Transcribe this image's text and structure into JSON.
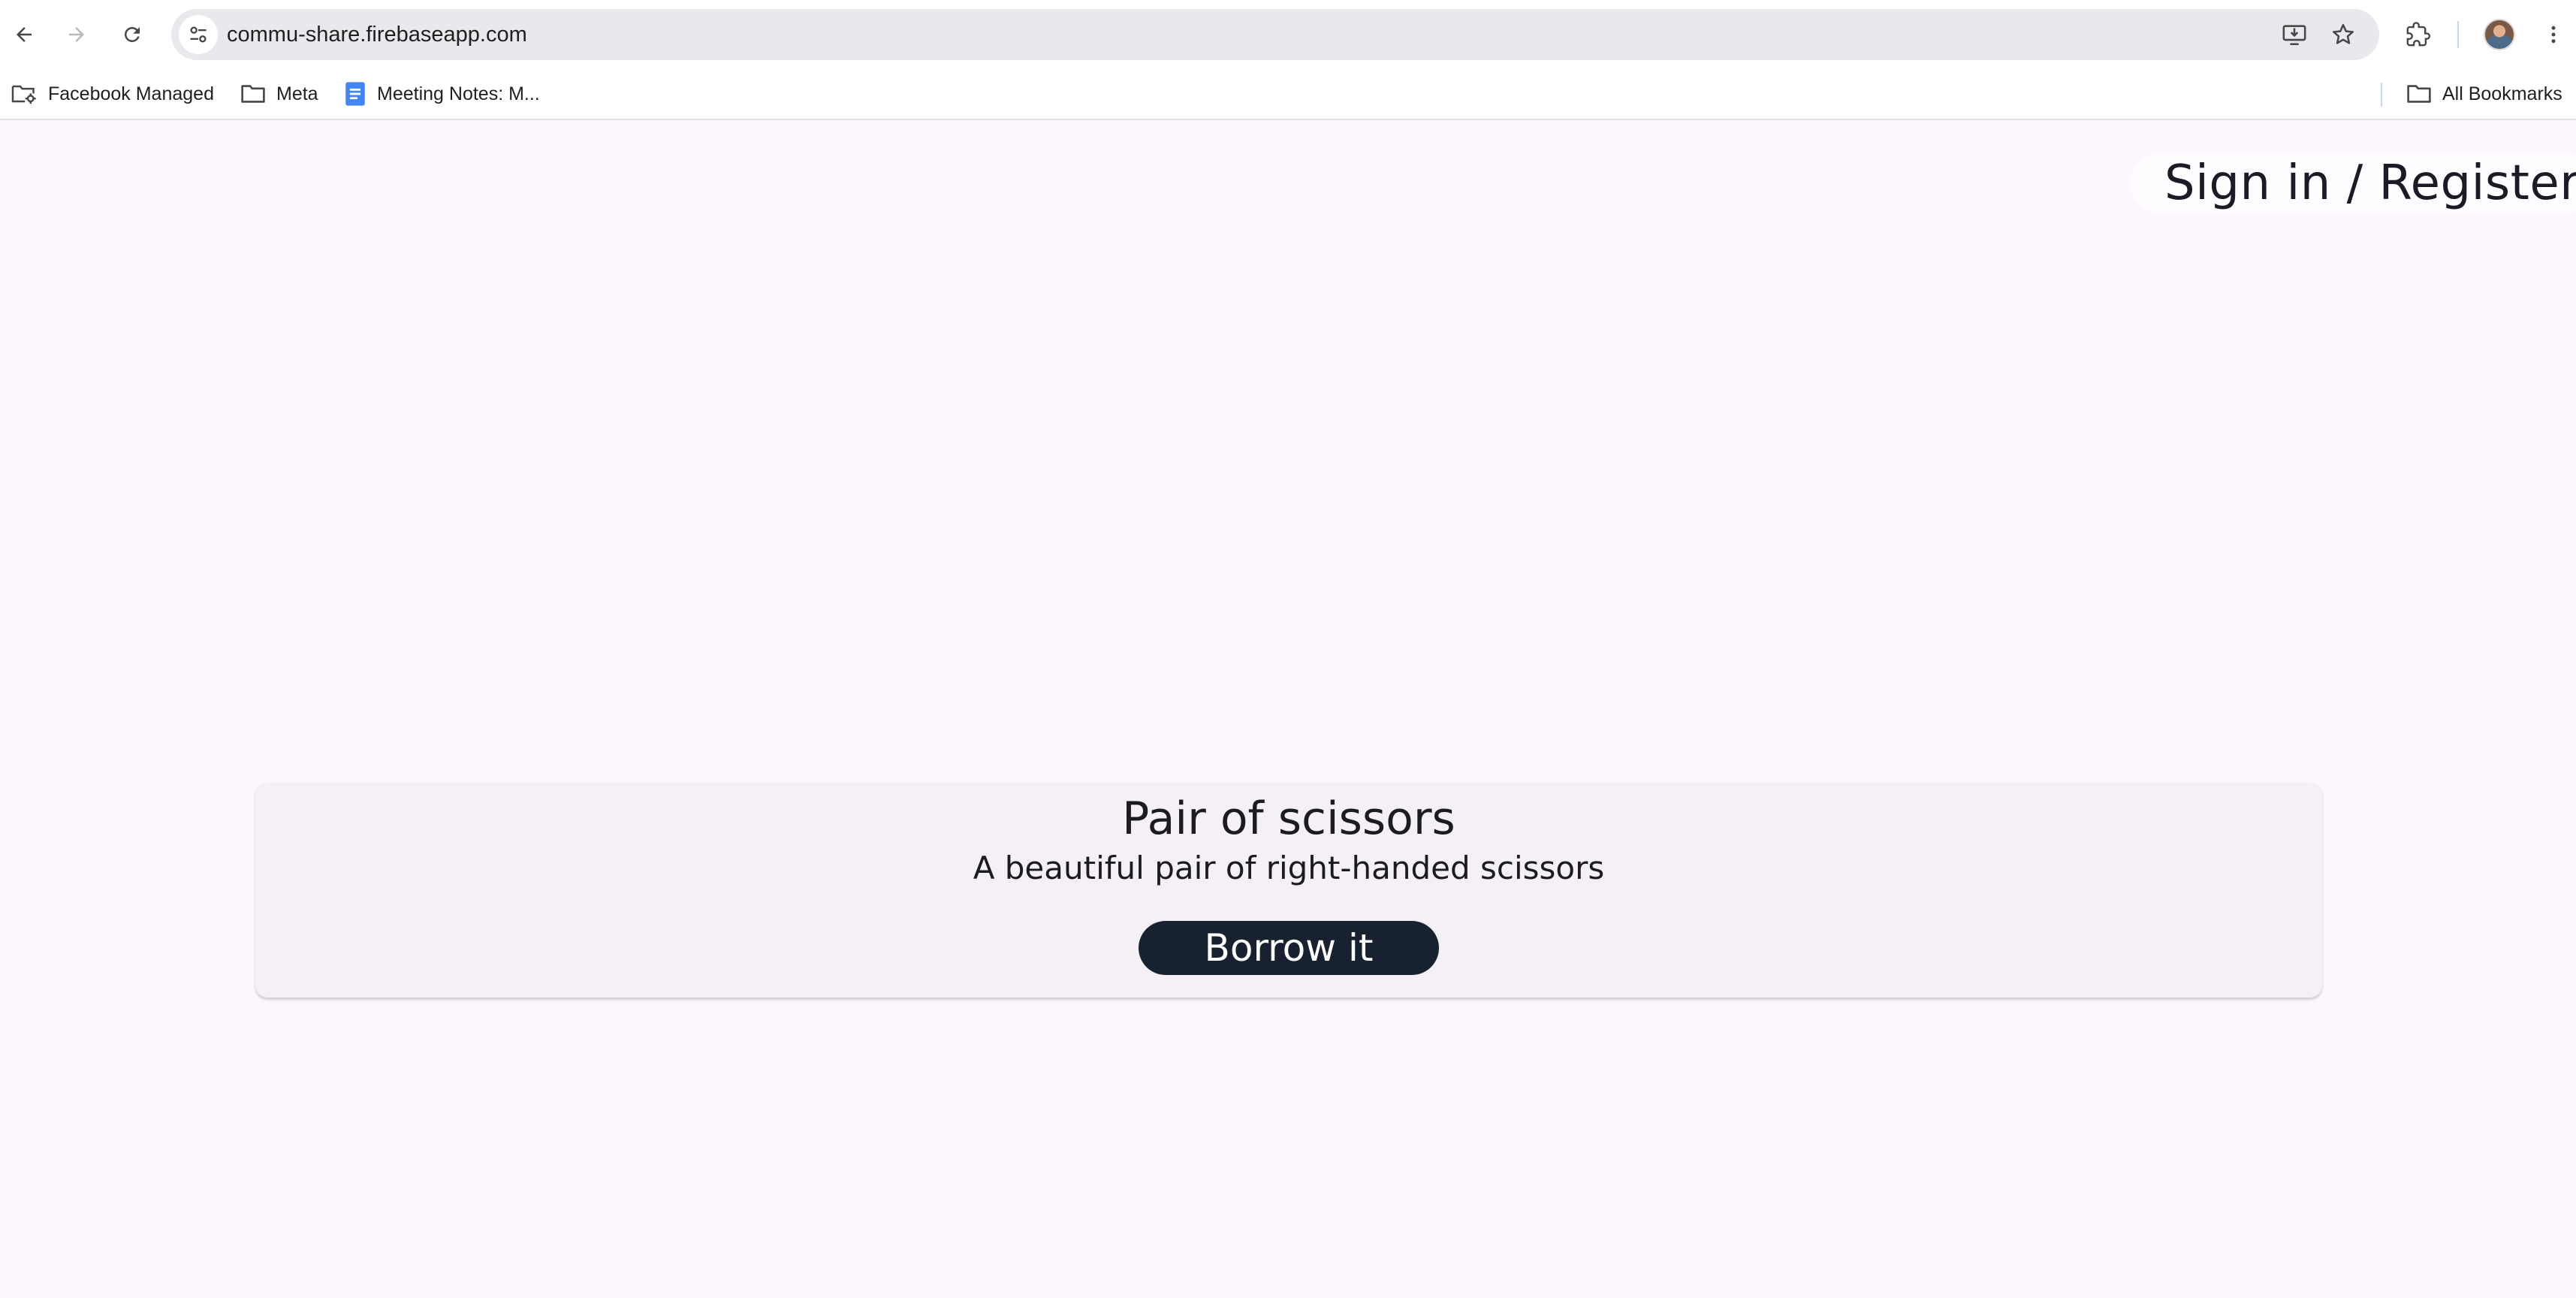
{
  "browser": {
    "url": "commu-share.firebaseapp.com",
    "bookmarks": [
      {
        "label": "Facebook Managed",
        "icon": "managed-folder-icon"
      },
      {
        "label": "Meta",
        "icon": "folder-icon"
      },
      {
        "label": "Meeting Notes: M...",
        "icon": "google-docs-icon"
      }
    ],
    "all_bookmarks_label": "All Bookmarks"
  },
  "header": {
    "signin_label": "Sign in / Register"
  },
  "item": {
    "title": "Pair of scissors",
    "description": "A beautiful pair of right-handed scissors",
    "action_label": "Borrow it"
  },
  "colors": {
    "page_background": "#fcf7fc",
    "card_background": "#f5f0f5",
    "button_background": "#17212f",
    "button_text": "#ffffff"
  }
}
